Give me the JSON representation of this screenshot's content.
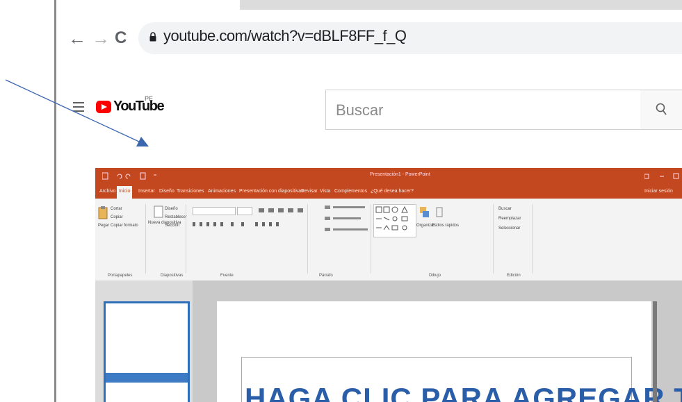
{
  "browser": {
    "back_label": "←",
    "forward_label": "→",
    "reload_label": "C",
    "url": "youtube.com/watch?v=dBLF8FF_f_Q"
  },
  "youtube": {
    "logo_word": "YouTube",
    "country_code": "PE",
    "search_placeholder": "Buscar"
  },
  "powerpoint": {
    "window_title": "Presentación1 - PowerPoint",
    "tabs": [
      "Archivo",
      "Inicio",
      "Insertar",
      "Diseño",
      "Transiciones",
      "Animaciones",
      "Presentación con diapositivas",
      "Revisar",
      "Vista",
      "Complementos",
      "¿Qué desea hacer?"
    ],
    "user_label": "Iniciar sesión",
    "ribbon_groups": [
      "Portapapeles",
      "Diapositivas",
      "Fuente",
      "Párrafo",
      "Dibujo",
      "Edición"
    ],
    "clipboard_items": [
      "Pegar",
      "Cortar",
      "Copiar",
      "Copiar formato"
    ],
    "slides_items": [
      "Nueva diapositiva",
      "Diseño",
      "Restablecer",
      "Sección"
    ],
    "editing_items": [
      "Buscar",
      "Reemplazar",
      "Seleccionar"
    ],
    "drawing_items": [
      "Organizar",
      "Estilos rápidos"
    ],
    "slide_title": "HAGA CLIC PARA AGREGAR TÍTULO"
  },
  "colors": {
    "ppt_orange": "#c4481f",
    "youtube_red": "#ff0000",
    "annotation_arrow": "#3a66b0"
  }
}
